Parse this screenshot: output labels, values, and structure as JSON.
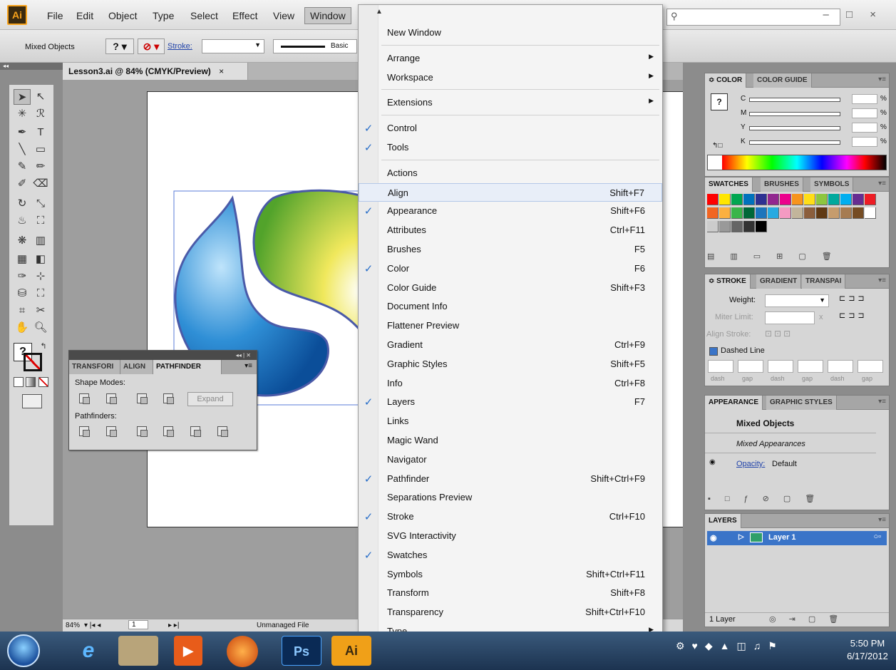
{
  "app": {
    "logo": "Ai",
    "menus": [
      "File",
      "Edit",
      "Object",
      "Type",
      "Select",
      "Effect",
      "View",
      "Window"
    ],
    "active_menu": "Window",
    "window_controls": "– □ ×"
  },
  "control_bar": {
    "selection": "Mixed Objects",
    "stroke_label": "Stroke:",
    "brush_label": "Basic"
  },
  "document": {
    "tab_title": "Lesson3.ai @ 84% (CMYK/Preview)",
    "tab_close": "×",
    "zoom": "84%",
    "artboard_number": "1",
    "status": "Unmanaged File"
  },
  "pathfinder_panel": {
    "tabs": [
      "TRANSFORI",
      "ALIGN",
      "PATHFINDER"
    ],
    "active_tab": "PATHFINDER",
    "shape_modes_label": "Shape Modes:",
    "expand_label": "Expand",
    "pathfinders_label": "Pathfinders:"
  },
  "color_panel": {
    "tabs": [
      "≎ COLOR",
      "COLOR GUIDE"
    ],
    "channels": [
      "C",
      "M",
      "Y",
      "K"
    ],
    "unit": "%"
  },
  "swatches_panel": {
    "tabs": [
      "SWATCHES",
      "BRUSHES",
      "SYMBOLS"
    ],
    "colors": [
      "#ff0000",
      "#ffe600",
      "#00a650",
      "#0072bc",
      "#2e3192",
      "#92278f",
      "#ec008c",
      "#f7941d",
      "#ffde17",
      "#8dc63f",
      "#00a99d",
      "#00aeef",
      "#662d91",
      "#ed1c24",
      "#f26522",
      "#fbb040",
      "#39b54a",
      "#006838",
      "#1c75bc",
      "#27aae1",
      "#f49ac2",
      "#c2b59b",
      "#8b5e3c",
      "#603913",
      "#c69c6d",
      "#a67c52",
      "#754c24",
      "#ffffff",
      "#cccccc",
      "#999999",
      "#666666",
      "#333333",
      "#000000"
    ]
  },
  "stroke_panel": {
    "tabs": [
      "≎ STROKE",
      "GRADIENT",
      "TRANSPAI"
    ],
    "weight_label": "Weight:",
    "miter_label": "Miter Limit:",
    "miter_unit": "x",
    "align_label": "Align Stroke:",
    "dashed_label": "Dashed Line",
    "dash_labels": [
      "dash",
      "gap",
      "dash",
      "gap",
      "dash",
      "gap"
    ]
  },
  "appearance_panel": {
    "tabs": [
      "APPEARANCE",
      "GRAPHIC STYLES"
    ],
    "title": "Mixed Objects",
    "subtitle": "Mixed Appearances",
    "opacity_label": "Opacity:",
    "opacity_value": "Default"
  },
  "layers_panel": {
    "tab": "LAYERS",
    "layer_name": "Layer 1",
    "footer": "1 Layer"
  },
  "window_menu": {
    "items": [
      {
        "label": "New Window",
        "check": false,
        "shortcut": "",
        "submenu": false
      },
      {
        "label": "Arrange",
        "check": false,
        "shortcut": "",
        "submenu": true
      },
      {
        "label": "Workspace",
        "check": false,
        "shortcut": "",
        "submenu": true
      },
      {
        "label": "Extensions",
        "check": false,
        "shortcut": "",
        "submenu": true
      },
      {
        "label": "Control",
        "check": true,
        "shortcut": "",
        "submenu": false
      },
      {
        "label": "Tools",
        "check": true,
        "shortcut": "",
        "submenu": false
      },
      {
        "label": "Actions",
        "check": false,
        "shortcut": "",
        "submenu": false
      },
      {
        "label": "Align",
        "check": false,
        "shortcut": "Shift+F7",
        "submenu": false
      },
      {
        "label": "Appearance",
        "check": true,
        "shortcut": "Shift+F6",
        "submenu": false
      },
      {
        "label": "Attributes",
        "check": false,
        "shortcut": "Ctrl+F11",
        "submenu": false
      },
      {
        "label": "Brushes",
        "check": false,
        "shortcut": "F5",
        "submenu": false
      },
      {
        "label": "Color",
        "check": true,
        "shortcut": "F6",
        "submenu": false
      },
      {
        "label": "Color Guide",
        "check": false,
        "shortcut": "Shift+F3",
        "submenu": false
      },
      {
        "label": "Document Info",
        "check": false,
        "shortcut": "",
        "submenu": false
      },
      {
        "label": "Flattener Preview",
        "check": false,
        "shortcut": "",
        "submenu": false
      },
      {
        "label": "Gradient",
        "check": false,
        "shortcut": "Ctrl+F9",
        "submenu": false
      },
      {
        "label": "Graphic Styles",
        "check": false,
        "shortcut": "Shift+F5",
        "submenu": false
      },
      {
        "label": "Info",
        "check": false,
        "shortcut": "Ctrl+F8",
        "submenu": false
      },
      {
        "label": "Layers",
        "check": true,
        "shortcut": "F7",
        "submenu": false
      },
      {
        "label": "Links",
        "check": false,
        "shortcut": "",
        "submenu": false
      },
      {
        "label": "Magic Wand",
        "check": false,
        "shortcut": "",
        "submenu": false
      },
      {
        "label": "Navigator",
        "check": false,
        "shortcut": "",
        "submenu": false
      },
      {
        "label": "Pathfinder",
        "check": true,
        "shortcut": "Shift+Ctrl+F9",
        "submenu": false
      },
      {
        "label": "Separations Preview",
        "check": false,
        "shortcut": "",
        "submenu": false
      },
      {
        "label": "Stroke",
        "check": true,
        "shortcut": "Ctrl+F10",
        "submenu": false
      },
      {
        "label": "SVG Interactivity",
        "check": false,
        "shortcut": "",
        "submenu": false
      },
      {
        "label": "Swatches",
        "check": true,
        "shortcut": "",
        "submenu": false
      },
      {
        "label": "Symbols",
        "check": false,
        "shortcut": "Shift+Ctrl+F11",
        "submenu": false
      },
      {
        "label": "Transform",
        "check": false,
        "shortcut": "Shift+F8",
        "submenu": false
      },
      {
        "label": "Transparency",
        "check": false,
        "shortcut": "Shift+Ctrl+F10",
        "submenu": false
      },
      {
        "label": "Type",
        "check": false,
        "shortcut": "",
        "submenu": true
      }
    ],
    "highlighted": "Align"
  },
  "taskbar": {
    "apps": [
      "e",
      "Ps",
      "Ai"
    ],
    "time": "5:50 PM",
    "date": "6/17/2012"
  }
}
